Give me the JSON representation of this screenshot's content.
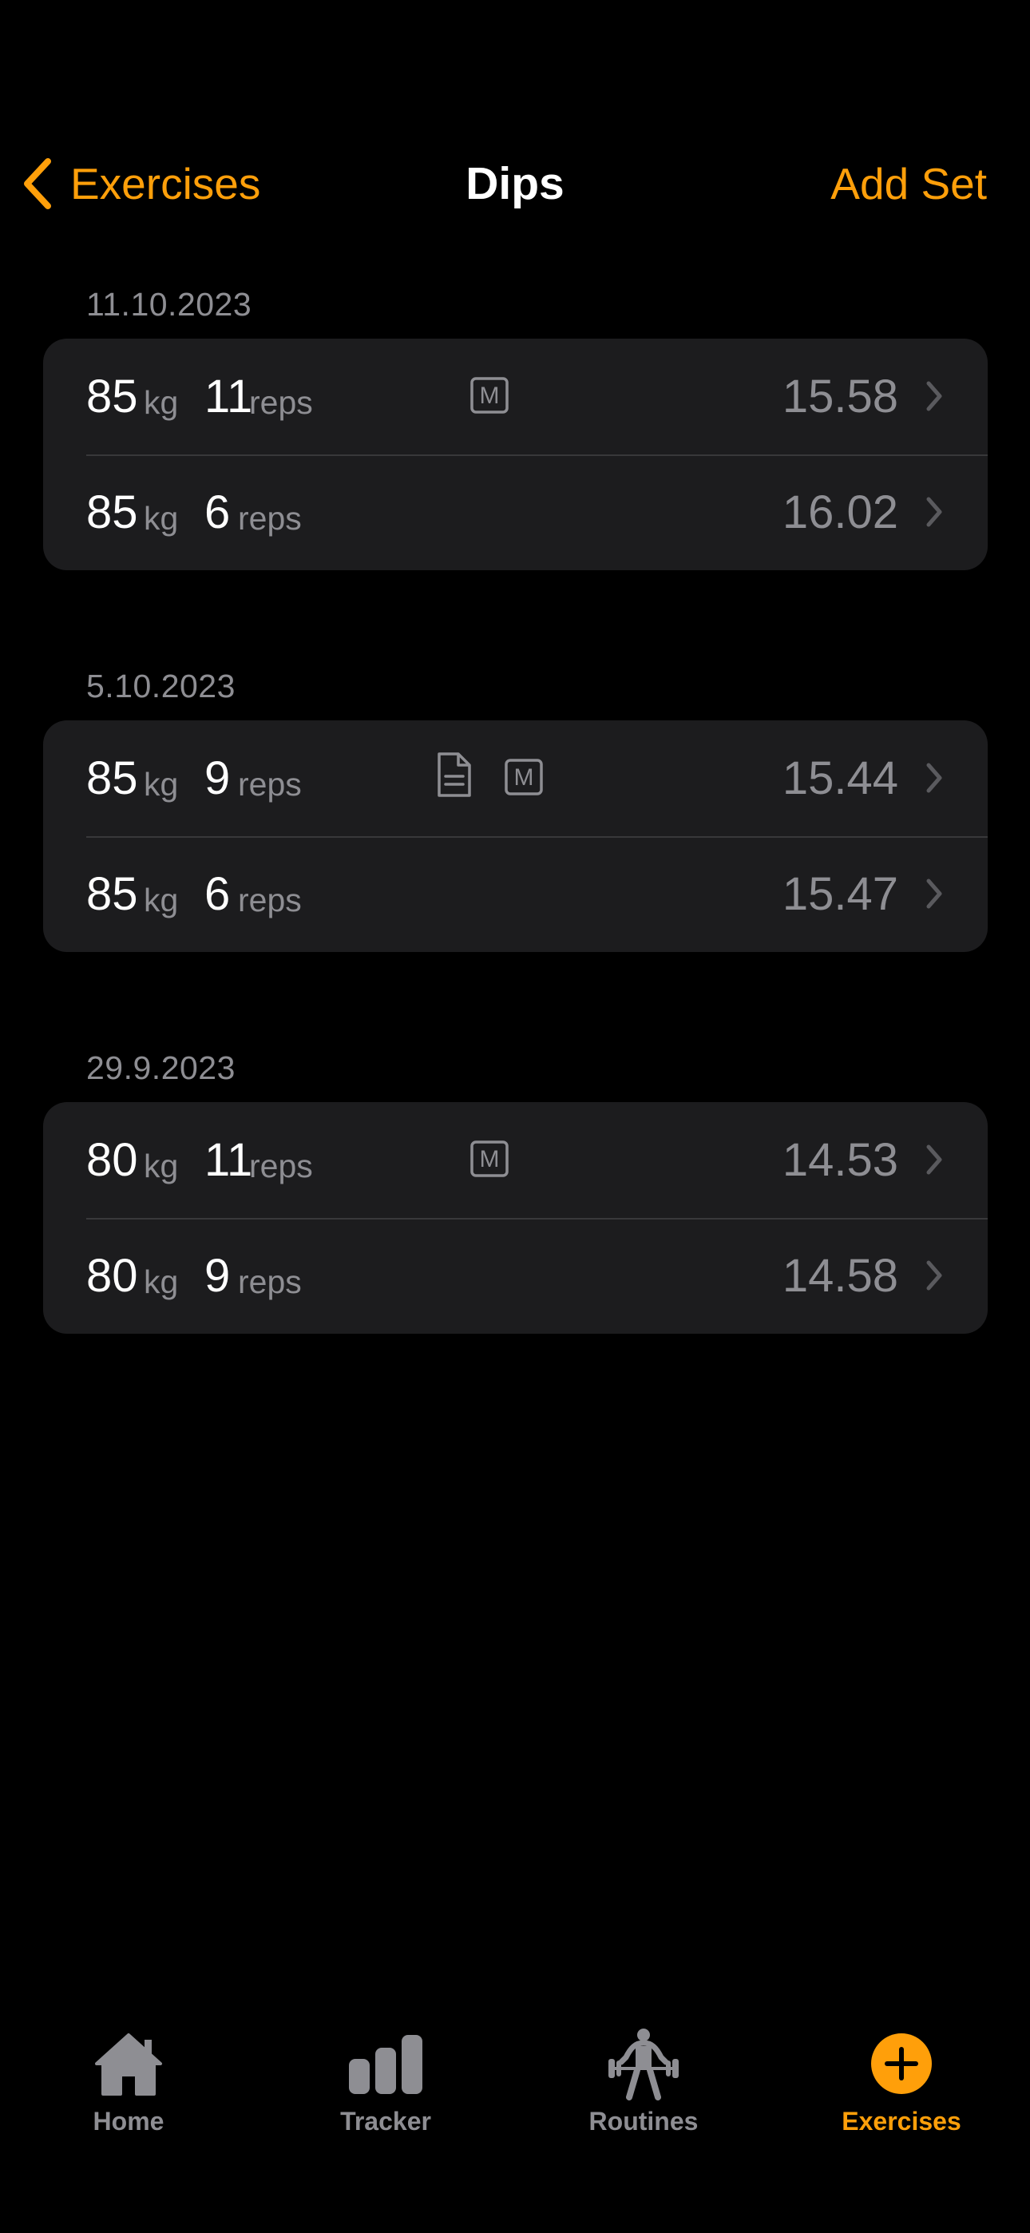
{
  "nav": {
    "back_label": "Exercises",
    "title": "Dips",
    "action_label": "Add Set"
  },
  "sections": [
    {
      "date": "11.10.2023",
      "rows": [
        {
          "weight": "85",
          "weight_unit": "kg",
          "reps": "11",
          "reps_unit": "reps",
          "badges": [
            "m-badge-icon"
          ],
          "score": "15.58"
        },
        {
          "weight": "85",
          "weight_unit": "kg",
          "reps": "6",
          "reps_unit": "reps",
          "badges": [],
          "score": "16.02"
        }
      ]
    },
    {
      "date": "5.10.2023",
      "rows": [
        {
          "weight": "85",
          "weight_unit": "kg",
          "reps": "9",
          "reps_unit": "reps",
          "badges": [
            "note-icon",
            "m-badge-icon"
          ],
          "score": "15.44"
        },
        {
          "weight": "85",
          "weight_unit": "kg",
          "reps": "6",
          "reps_unit": "reps",
          "badges": [],
          "score": "15.47"
        }
      ]
    },
    {
      "date": "29.9.2023",
      "rows": [
        {
          "weight": "80",
          "weight_unit": "kg",
          "reps": "11",
          "reps_unit": "reps",
          "badges": [
            "m-badge-icon"
          ],
          "score": "14.53"
        },
        {
          "weight": "80",
          "weight_unit": "kg",
          "reps": "9",
          "reps_unit": "reps",
          "badges": [],
          "score": "14.58"
        }
      ]
    }
  ],
  "badge_letter": "M",
  "tabs": [
    {
      "label": "Home",
      "icon": "house-icon",
      "active": false
    },
    {
      "label": "Tracker",
      "icon": "bar-chart-icon",
      "active": false
    },
    {
      "label": "Routines",
      "icon": "weightlifter-icon",
      "active": false
    },
    {
      "label": "Exercises",
      "icon": "plus-circle-icon",
      "active": true
    }
  ],
  "colors": {
    "accent": "#FF9F0A",
    "background": "#000000",
    "card": "#1C1C1E",
    "secondary_text": "#8E8E93",
    "separator": "#38383A"
  }
}
